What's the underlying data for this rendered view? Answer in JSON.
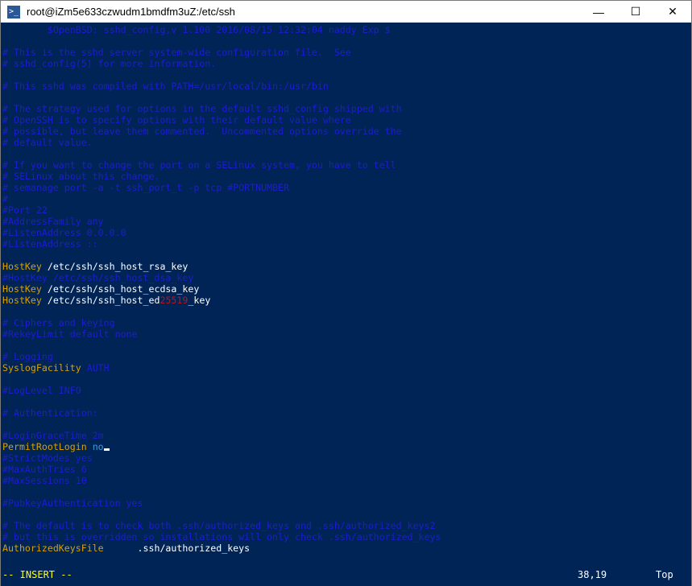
{
  "window": {
    "title": "root@iZm5e633czwudm1bmdfm3uZ:/etc/ssh",
    "icon": "powershell-icon",
    "minimize": "—",
    "maximize": "☐",
    "close": "✕"
  },
  "editor": {
    "lines": [
      {
        "segments": [
          {
            "t": "comment",
            "v": "\t$OpenBSD: sshd_config,v 1.100 2016/08/15 12:32:04 naddy Exp $"
          }
        ]
      },
      {
        "segments": []
      },
      {
        "segments": [
          {
            "t": "comment",
            "v": "# This is the sshd server system-wide configuration file.  See"
          }
        ]
      },
      {
        "segments": [
          {
            "t": "comment",
            "v": "# sshd_config(5) for more information."
          }
        ]
      },
      {
        "segments": []
      },
      {
        "segments": [
          {
            "t": "comment",
            "v": "# This sshd was compiled with PATH=/usr/local/bin:/usr/bin"
          }
        ]
      },
      {
        "segments": []
      },
      {
        "segments": [
          {
            "t": "comment",
            "v": "# The strategy used for options in the default sshd_config shipped with"
          }
        ]
      },
      {
        "segments": [
          {
            "t": "comment",
            "v": "# OpenSSH is to specify options with their default value where"
          }
        ]
      },
      {
        "segments": [
          {
            "t": "comment",
            "v": "# possible, but leave them commented.  Uncommented options override the"
          }
        ]
      },
      {
        "segments": [
          {
            "t": "comment",
            "v": "# default value."
          }
        ]
      },
      {
        "segments": []
      },
      {
        "segments": [
          {
            "t": "comment",
            "v": "# If you want to change the port on a SELinux system, you have to tell"
          }
        ]
      },
      {
        "segments": [
          {
            "t": "comment",
            "v": "# SELinux about this change."
          }
        ]
      },
      {
        "segments": [
          {
            "t": "comment",
            "v": "# semanage port -a -t ssh_port_t -p tcp #PORTNUMBER"
          }
        ]
      },
      {
        "segments": [
          {
            "t": "comment",
            "v": "#"
          }
        ]
      },
      {
        "segments": [
          {
            "t": "comment",
            "v": "#Port 22"
          }
        ]
      },
      {
        "segments": [
          {
            "t": "comment",
            "v": "#AddressFamily any"
          }
        ]
      },
      {
        "segments": [
          {
            "t": "comment",
            "v": "#ListenAddress 0.0.0.0"
          }
        ]
      },
      {
        "segments": [
          {
            "t": "comment",
            "v": "#ListenAddress ::"
          }
        ]
      },
      {
        "segments": []
      },
      {
        "segments": [
          {
            "t": "keyword",
            "v": "HostKey"
          },
          {
            "t": "value",
            "v": " /etc/ssh/ssh_host_rsa_key"
          }
        ]
      },
      {
        "segments": [
          {
            "t": "comment",
            "v": "#HostKey /etc/ssh/ssh_host_dsa_key"
          }
        ]
      },
      {
        "segments": [
          {
            "t": "keyword",
            "v": "HostKey"
          },
          {
            "t": "value",
            "v": " /etc/ssh/ssh_host_ecdsa_key"
          }
        ]
      },
      {
        "segments": [
          {
            "t": "keyword",
            "v": "HostKey"
          },
          {
            "t": "value",
            "v": " /etc/ssh/ssh_host_ed"
          },
          {
            "t": "red",
            "v": "25519"
          },
          {
            "t": "value",
            "v": "_key"
          }
        ]
      },
      {
        "segments": []
      },
      {
        "segments": [
          {
            "t": "comment",
            "v": "# Ciphers and keying"
          }
        ]
      },
      {
        "segments": [
          {
            "t": "comment",
            "v": "#RekeyLimit default none"
          }
        ]
      },
      {
        "segments": []
      },
      {
        "segments": [
          {
            "t": "comment",
            "v": "# Logging"
          }
        ]
      },
      {
        "segments": [
          {
            "t": "keyword",
            "v": "SyslogFacility"
          },
          {
            "t": "comment",
            "v": " AUTH"
          }
        ]
      },
      {
        "segments": []
      },
      {
        "segments": [
          {
            "t": "comment",
            "v": "#LogLevel INFO"
          }
        ]
      },
      {
        "segments": []
      },
      {
        "segments": [
          {
            "t": "comment",
            "v": "# Authentication:"
          }
        ]
      },
      {
        "segments": []
      },
      {
        "segments": [
          {
            "t": "comment",
            "v": "#LoginGraceTime 2m"
          }
        ]
      },
      {
        "segments": [
          {
            "t": "keyword",
            "v": "PermitRootLogin"
          },
          {
            "t": "value",
            "v": " "
          },
          {
            "t": "no",
            "v": "no"
          },
          {
            "t": "cursor",
            "v": ""
          }
        ]
      },
      {
        "segments": [
          {
            "t": "comment",
            "v": "#StrictModes yes"
          }
        ]
      },
      {
        "segments": [
          {
            "t": "comment",
            "v": "#MaxAuthTries 6"
          }
        ]
      },
      {
        "segments": [
          {
            "t": "comment",
            "v": "#MaxSessions 10"
          }
        ]
      },
      {
        "segments": []
      },
      {
        "segments": [
          {
            "t": "comment",
            "v": "#PubkeyAuthentication yes"
          }
        ]
      },
      {
        "segments": []
      },
      {
        "segments": [
          {
            "t": "comment",
            "v": "# The default is to check both .ssh/authorized_keys and .ssh/authorized_keys2"
          }
        ]
      },
      {
        "segments": [
          {
            "t": "comment",
            "v": "# but this is overridden so installations will only check .ssh/authorized_keys"
          }
        ]
      },
      {
        "segments": [
          {
            "t": "keyword",
            "v": "AuthorizedKeysFile"
          },
          {
            "t": "value",
            "v": "      .ssh/authorized_keys"
          }
        ]
      }
    ]
  },
  "status": {
    "mode": "-- INSERT --",
    "position": "38,19",
    "scroll": "Top"
  },
  "colors": {
    "background": "#012456",
    "comment": "#1e1cd0",
    "keyword": "#d7a000",
    "mode": "#ffff00"
  }
}
